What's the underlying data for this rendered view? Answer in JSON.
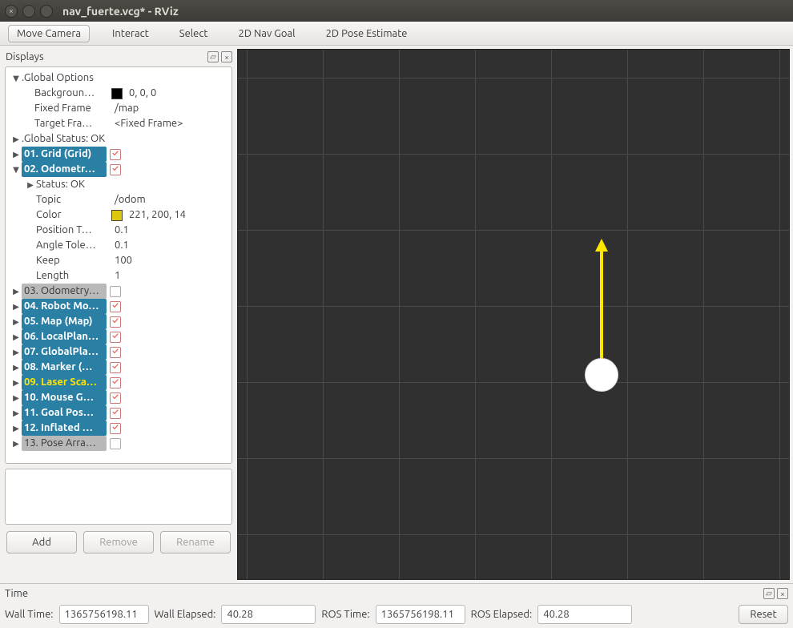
{
  "window": {
    "title": "nav_fuerte.vcg* - RViz"
  },
  "toolbar": {
    "move_camera": "Move Camera",
    "interact": "Interact",
    "select": "Select",
    "nav_goal": "2D Nav Goal",
    "pose_estimate": "2D Pose Estimate"
  },
  "displays": {
    "header": "Displays",
    "global_options": {
      "label": ".Global Options",
      "background": {
        "key": "Backgroun…",
        "value": "0, 0, 0",
        "color": "#000000"
      },
      "fixed_frame": {
        "key": "Fixed Frame",
        "value": "/map"
      },
      "target_frame": {
        "key": "Target Fra…",
        "value": "<Fixed Frame>"
      }
    },
    "global_status": ".Global Status: OK",
    "items": [
      {
        "label": "01. Grid (Grid)",
        "checked": true,
        "style": "sel bold"
      },
      {
        "label": "02. Odometr…",
        "checked": true,
        "style": "sel bold",
        "expanded": true,
        "children": {
          "status": "Status: OK",
          "topic": {
            "key": "Topic",
            "value": "/odom"
          },
          "color": {
            "key": "Color",
            "value": "221, 200, 14",
            "color": "#ddc80e"
          },
          "pos": {
            "key": "Position T…",
            "value": "0.1"
          },
          "angle": {
            "key": "Angle Tole…",
            "value": "0.1"
          },
          "keep": {
            "key": "Keep",
            "value": "100"
          },
          "length": {
            "key": "Length",
            "value": "1"
          }
        }
      },
      {
        "label": "03. Odometry…",
        "checked": false,
        "style": "grey"
      },
      {
        "label": "04. Robot Mo…",
        "checked": true,
        "style": "sel bold"
      },
      {
        "label": "05. Map (Map)",
        "checked": true,
        "style": "sel bold"
      },
      {
        "label": "06. LocalPlan…",
        "checked": true,
        "style": "sel bold"
      },
      {
        "label": "07. GlobalPla…",
        "checked": true,
        "style": "sel bold"
      },
      {
        "label": "08. Marker (…",
        "checked": true,
        "style": "sel bold"
      },
      {
        "label": "09. Laser Sca…",
        "checked": true,
        "style": "sel bold yellow"
      },
      {
        "label": "10. Mouse G…",
        "checked": true,
        "style": "sel bold"
      },
      {
        "label": "11. Goal Pos…",
        "checked": true,
        "style": "sel bold"
      },
      {
        "label": "12. Inflated …",
        "checked": true,
        "style": "sel bold"
      },
      {
        "label": "13. Pose Arra…",
        "checked": false,
        "style": "grey"
      }
    ]
  },
  "buttons": {
    "add": "Add",
    "remove": "Remove",
    "rename": "Rename"
  },
  "time": {
    "header": "Time",
    "wall_time": {
      "label": "Wall Time:",
      "value": "1365756198.11"
    },
    "wall_elapsed": {
      "label": "Wall Elapsed:",
      "value": "40.28"
    },
    "ros_time": {
      "label": "ROS Time:",
      "value": "1365756198.11"
    },
    "ros_elapsed": {
      "label": "ROS Elapsed:",
      "value": "40.28"
    },
    "reset": "Reset"
  }
}
